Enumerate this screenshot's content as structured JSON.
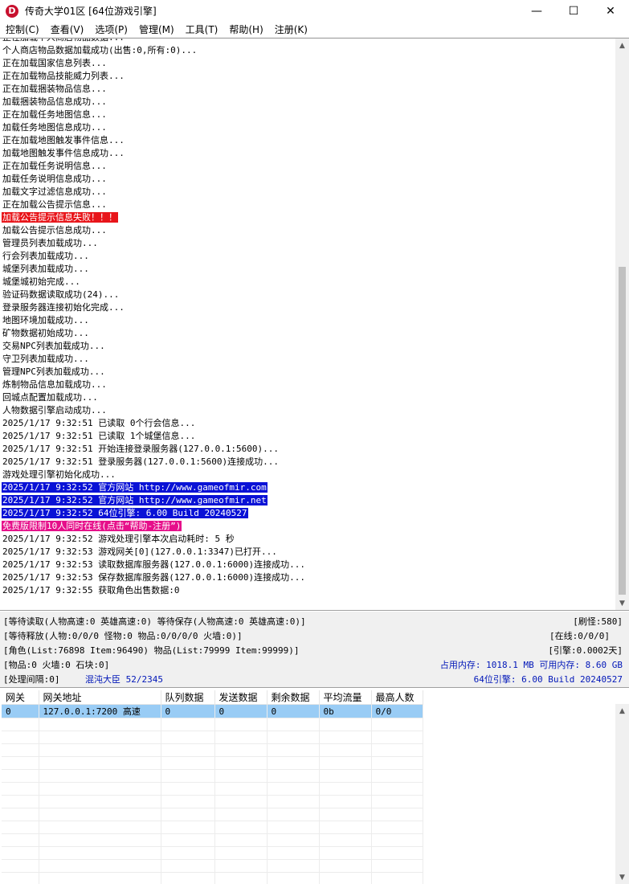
{
  "window": {
    "icon_letter": "D",
    "title": "传奇大学01区 [64位游戏引擎]",
    "minimize": "—",
    "maximize": "☐",
    "close": "✕"
  },
  "menu": [
    "控制(C)",
    "查看(V)",
    "选项(P)",
    "管理(M)",
    "工具(T)",
    "帮助(H)",
    "注册(K)"
  ],
  "log": [
    {
      "text": "正在加载个人商店物品数据...",
      "hl": ""
    },
    {
      "text": "个人商店物品数据加载成功(出售:0,所有:0)...",
      "hl": ""
    },
    {
      "text": "正在加载国家信息列表...",
      "hl": ""
    },
    {
      "text": "正在加载物品技能威力列表...",
      "hl": ""
    },
    {
      "text": "正在加载捆装物品信息...",
      "hl": ""
    },
    {
      "text": "加载捆装物品信息成功...",
      "hl": ""
    },
    {
      "text": "正在加载任务地图信息...",
      "hl": ""
    },
    {
      "text": "加载任务地图信息成功...",
      "hl": ""
    },
    {
      "text": "正在加载地图触发事件信息...",
      "hl": ""
    },
    {
      "text": "加载地图触发事件信息成功...",
      "hl": ""
    },
    {
      "text": "正在加载任务说明信息...",
      "hl": ""
    },
    {
      "text": "加载任务说明信息成功...",
      "hl": ""
    },
    {
      "text": "加载文字过滤信息成功...",
      "hl": ""
    },
    {
      "text": "正在加载公告提示信息...",
      "hl": ""
    },
    {
      "text": "加载公告提示信息失败！！！",
      "hl": "red"
    },
    {
      "text": "加载公告提示信息成功...",
      "hl": ""
    },
    {
      "text": "管理员列表加载成功...",
      "hl": ""
    },
    {
      "text": "行会列表加载成功...",
      "hl": ""
    },
    {
      "text": "城堡列表加载成功...",
      "hl": ""
    },
    {
      "text": "城堡城初始完成...",
      "hl": ""
    },
    {
      "text": "验证码数据读取成功(24)...",
      "hl": ""
    },
    {
      "text": "登录服务器连接初始化完成...",
      "hl": ""
    },
    {
      "text": "地图环境加载成功...",
      "hl": ""
    },
    {
      "text": "矿物数据初始成功...",
      "hl": ""
    },
    {
      "text": "交易NPC列表加载成功...",
      "hl": ""
    },
    {
      "text": "守卫列表加载成功...",
      "hl": ""
    },
    {
      "text": "管理NPC列表加载成功...",
      "hl": ""
    },
    {
      "text": "炼制物品信息加载成功...",
      "hl": ""
    },
    {
      "text": "回城点配置加载成功...",
      "hl": ""
    },
    {
      "text": "人物数据引擎启动成功...",
      "hl": ""
    },
    {
      "text": "2025/1/17 9:32:51 已读取 0个行会信息...",
      "hl": ""
    },
    {
      "text": "2025/1/17 9:32:51 已读取 1个城堡信息...",
      "hl": ""
    },
    {
      "text": "2025/1/17 9:32:51 开始连接登录服务器(127.0.0.1:5600)...",
      "hl": ""
    },
    {
      "text": "2025/1/17 9:32:51 登录服务器(127.0.0.1:5600)连接成功...",
      "hl": ""
    },
    {
      "text": "游戏处理引擎初始化成功...",
      "hl": ""
    },
    {
      "text": "2025/1/17 9:32:52 官方网站 http://www.gameofmir.com",
      "hl": "blue"
    },
    {
      "text": "2025/1/17 9:32:52 官方网站 http://www.gameofmir.net",
      "hl": "blue"
    },
    {
      "text": "2025/1/17 9:32:52 64位引擎: 6.00 Build 20240527",
      "hl": "blue"
    },
    {
      "text": "免费版限制10人同时在线(点击“帮助-注册”)",
      "hl": "pink"
    },
    {
      "text": "2025/1/17 9:32:52 游戏处理引擎本次启动耗时: 5 秒",
      "hl": ""
    },
    {
      "text": "2025/1/17 9:32:53 游戏网关[0](127.0.0.1:3347)已打开...",
      "hl": ""
    },
    {
      "text": "2025/1/17 9:32:53 读取数据库服务器(127.0.0.1:6000)连接成功...",
      "hl": ""
    },
    {
      "text": "2025/1/17 9:32:53 保存数据库服务器(127.0.0.1:6000)连接成功...",
      "hl": ""
    },
    {
      "text": "2025/1/17 9:32:55 获取角色出售数据:0",
      "hl": ""
    }
  ],
  "status": {
    "line1_left": "[等待读取(人物高速:0 英雄高速:0) 等待保存(人物高速:0 英雄高速:0)]",
    "line1_right": "[刷怪:580]",
    "line2_left": "[等待释放(人物:0/0/0 怪物:0 物品:0/0/0/0 火墙:0)]",
    "line2_right": "[在线:0/0/0]",
    "line3_left": "[角色(List:76898 Item:96490) 物品(List:79999 Item:99999)]",
    "line3_right": "[引擎:0.0002天]",
    "line4_left": "[物品:0 火墙:0 石块:0]",
    "line4_right": "占用内存: 1018.1 MB 可用内存: 8.60 GB",
    "line5_left": "[处理间隔:0]",
    "line5_mid": "混沌大臣 52/2345",
    "line5_right": "64位引擎: 6.00 Build 20240527"
  },
  "gateway_table": {
    "headers": [
      "网关",
      "网关地址",
      "队列数据",
      "发送数据",
      "剩余数据",
      "平均流量",
      "最高人数"
    ],
    "rows": [
      [
        "0",
        "127.0.0.1:7200 高速",
        "0",
        "0",
        "0",
        "0b",
        "0/0"
      ]
    ],
    "empty_rows": 14
  },
  "colors": {
    "error_highlight": "#e8151a",
    "info_highlight": "#0a12d6",
    "notice_highlight": "#e60f8a",
    "selected_row": "#99ccf5",
    "status_blue": "#0016b8"
  }
}
